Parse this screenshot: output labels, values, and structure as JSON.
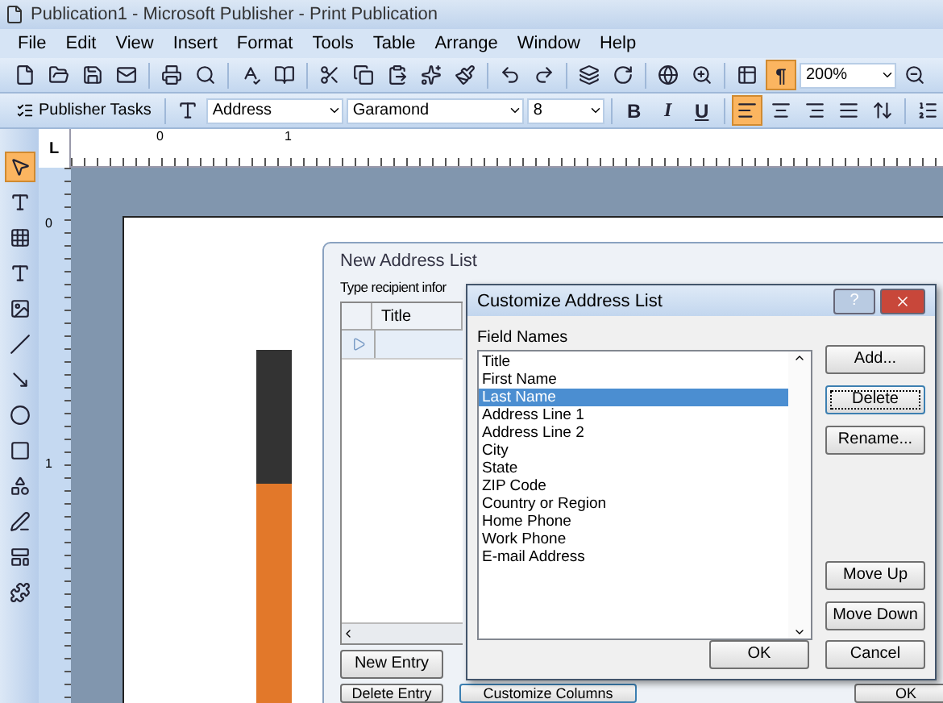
{
  "window": {
    "title": "Publication1 - Microsoft Publisher - Print Publication"
  },
  "menu": [
    "File",
    "Edit",
    "View",
    "Insert",
    "Format",
    "Tools",
    "Table",
    "Arrange",
    "Window",
    "Help"
  ],
  "standard_toolbar": {
    "show_marks": {
      "label": "¶",
      "selected": true
    },
    "zoom": "200%"
  },
  "formatting_toolbar": {
    "tasks": "Publisher Tasks",
    "style": "Address",
    "font": "Garamond",
    "size": "8",
    "bold": "B",
    "italic": "I",
    "underline": "U",
    "alignment": [
      {
        "selected": true
      },
      {
        "selected": false
      },
      {
        "selected": false
      },
      {
        "selected": false
      }
    ]
  },
  "ruler": {
    "corner": "L",
    "h_labels": [
      "0",
      "1"
    ],
    "v_labels": [
      "0",
      "1"
    ]
  },
  "tools": [
    {
      "selected": true
    },
    {
      "selected": false
    },
    {
      "selected": false
    },
    {
      "selected": false
    },
    {
      "selected": false
    },
    {
      "selected": false
    },
    {
      "selected": false
    },
    {
      "selected": false
    },
    {
      "selected": false
    },
    {
      "selected": false
    },
    {
      "selected": false
    },
    {
      "selected": false
    },
    {
      "selected": false
    }
  ],
  "new_address_list": {
    "title": "New Address List",
    "instruction": "Type recipient infor",
    "columns": [
      "Title"
    ],
    "buttons": [
      "New Entry",
      "Delete Entry",
      "Customize Columns",
      "OK"
    ]
  },
  "customize_dialog": {
    "title": "Customize Address List",
    "help": "?",
    "field_names_label": "Field Names",
    "fields": [
      {
        "label": "Title",
        "selected": false
      },
      {
        "label": "First Name",
        "selected": false
      },
      {
        "label": "Last Name",
        "selected": true
      },
      {
        "label": "Address Line 1",
        "selected": false
      },
      {
        "label": "Address Line 2",
        "selected": false
      },
      {
        "label": "City",
        "selected": false
      },
      {
        "label": "State",
        "selected": false
      },
      {
        "label": "ZIP Code",
        "selected": false
      },
      {
        "label": "Country or Region",
        "selected": false
      },
      {
        "label": "Home Phone",
        "selected": false
      },
      {
        "label": "Work Phone",
        "selected": false
      },
      {
        "label": "E-mail Address",
        "selected": false
      }
    ],
    "side_buttons": [
      "Add...",
      "Delete",
      "Rename...",
      "Move Up",
      "Move Down"
    ],
    "buttons": [
      "OK",
      "Cancel"
    ]
  }
}
